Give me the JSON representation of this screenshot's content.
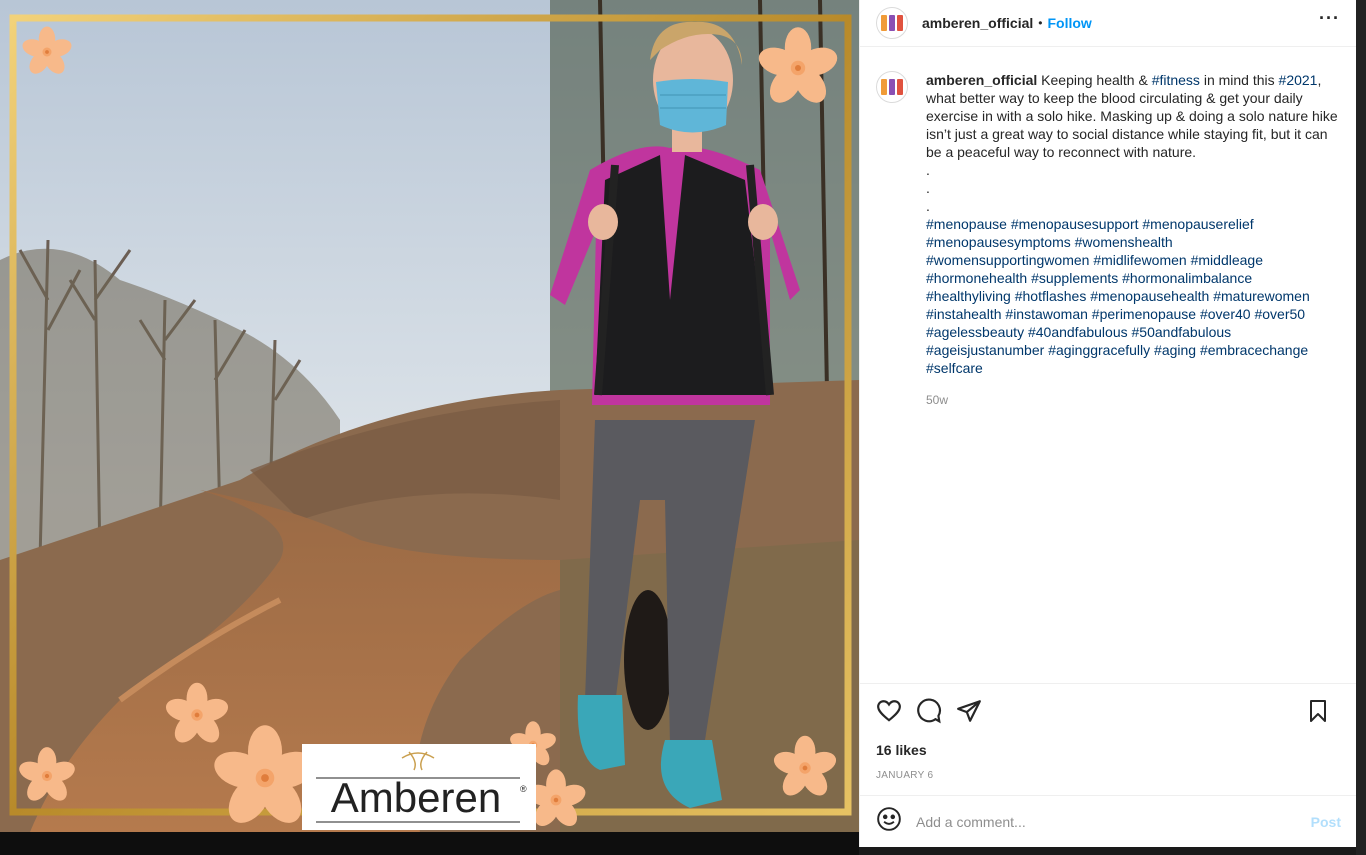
{
  "post": {
    "username": "amberen_official",
    "follow_label": "Follow",
    "dot": "•",
    "more_label": "···",
    "caption": {
      "text_intro_1": "Keeping health & ",
      "tag_fitness": "#fitness",
      "text_intro_2": " in mind this ",
      "tag_2021": "#2021",
      "text_body": ", what better way to keep the blood circulating & get your daily exercise in with a solo hike. Masking up & doing a solo nature hike isn’t just a great way to social distance while staying fit, but it can be a peaceful way to reconnect with nature.",
      "dot1": ".",
      "dot2": ".",
      "dot3": ".",
      "hashtags": [
        "#menopause",
        "#menopausesupport",
        "#menopauserelief",
        "#menopausesymptoms",
        "#womenshealth",
        "#womensupportingwomen",
        "#midlifewomen",
        "#middleage",
        "#hormonehealth",
        "#supplements",
        "#hormonalimbalance",
        "#healthyliving",
        "#hotflashes",
        "#menopausehealth",
        "#maturewomen",
        "#instahealth",
        "#instawoman",
        "#perimenopause",
        "#over40",
        "#over50",
        "#agelessbeauty",
        "#40andfabulous",
        "#50andfabulous",
        "#ageisjustanumber",
        "#aginggracefully",
        "#aging",
        "#embracechange",
        "#selfcare"
      ]
    },
    "time_ago": "50w",
    "likes": "16 likes",
    "date": "JANUARY 6",
    "comment_placeholder": "Add a comment...",
    "post_button": "Post"
  },
  "image": {
    "logo_text": "Amberen",
    "registered": "®"
  },
  "colors": {
    "accent": "#0095f6",
    "hashtag": "#00376b",
    "frame_gold": "#c9a23a",
    "flower": "#f7b98a",
    "jacket": "#c0359e",
    "mask": "#5fb6d8"
  },
  "icons": [
    "heart-icon",
    "comment-icon",
    "share-icon",
    "bookmark-icon",
    "emoji-icon",
    "more-icon"
  ]
}
